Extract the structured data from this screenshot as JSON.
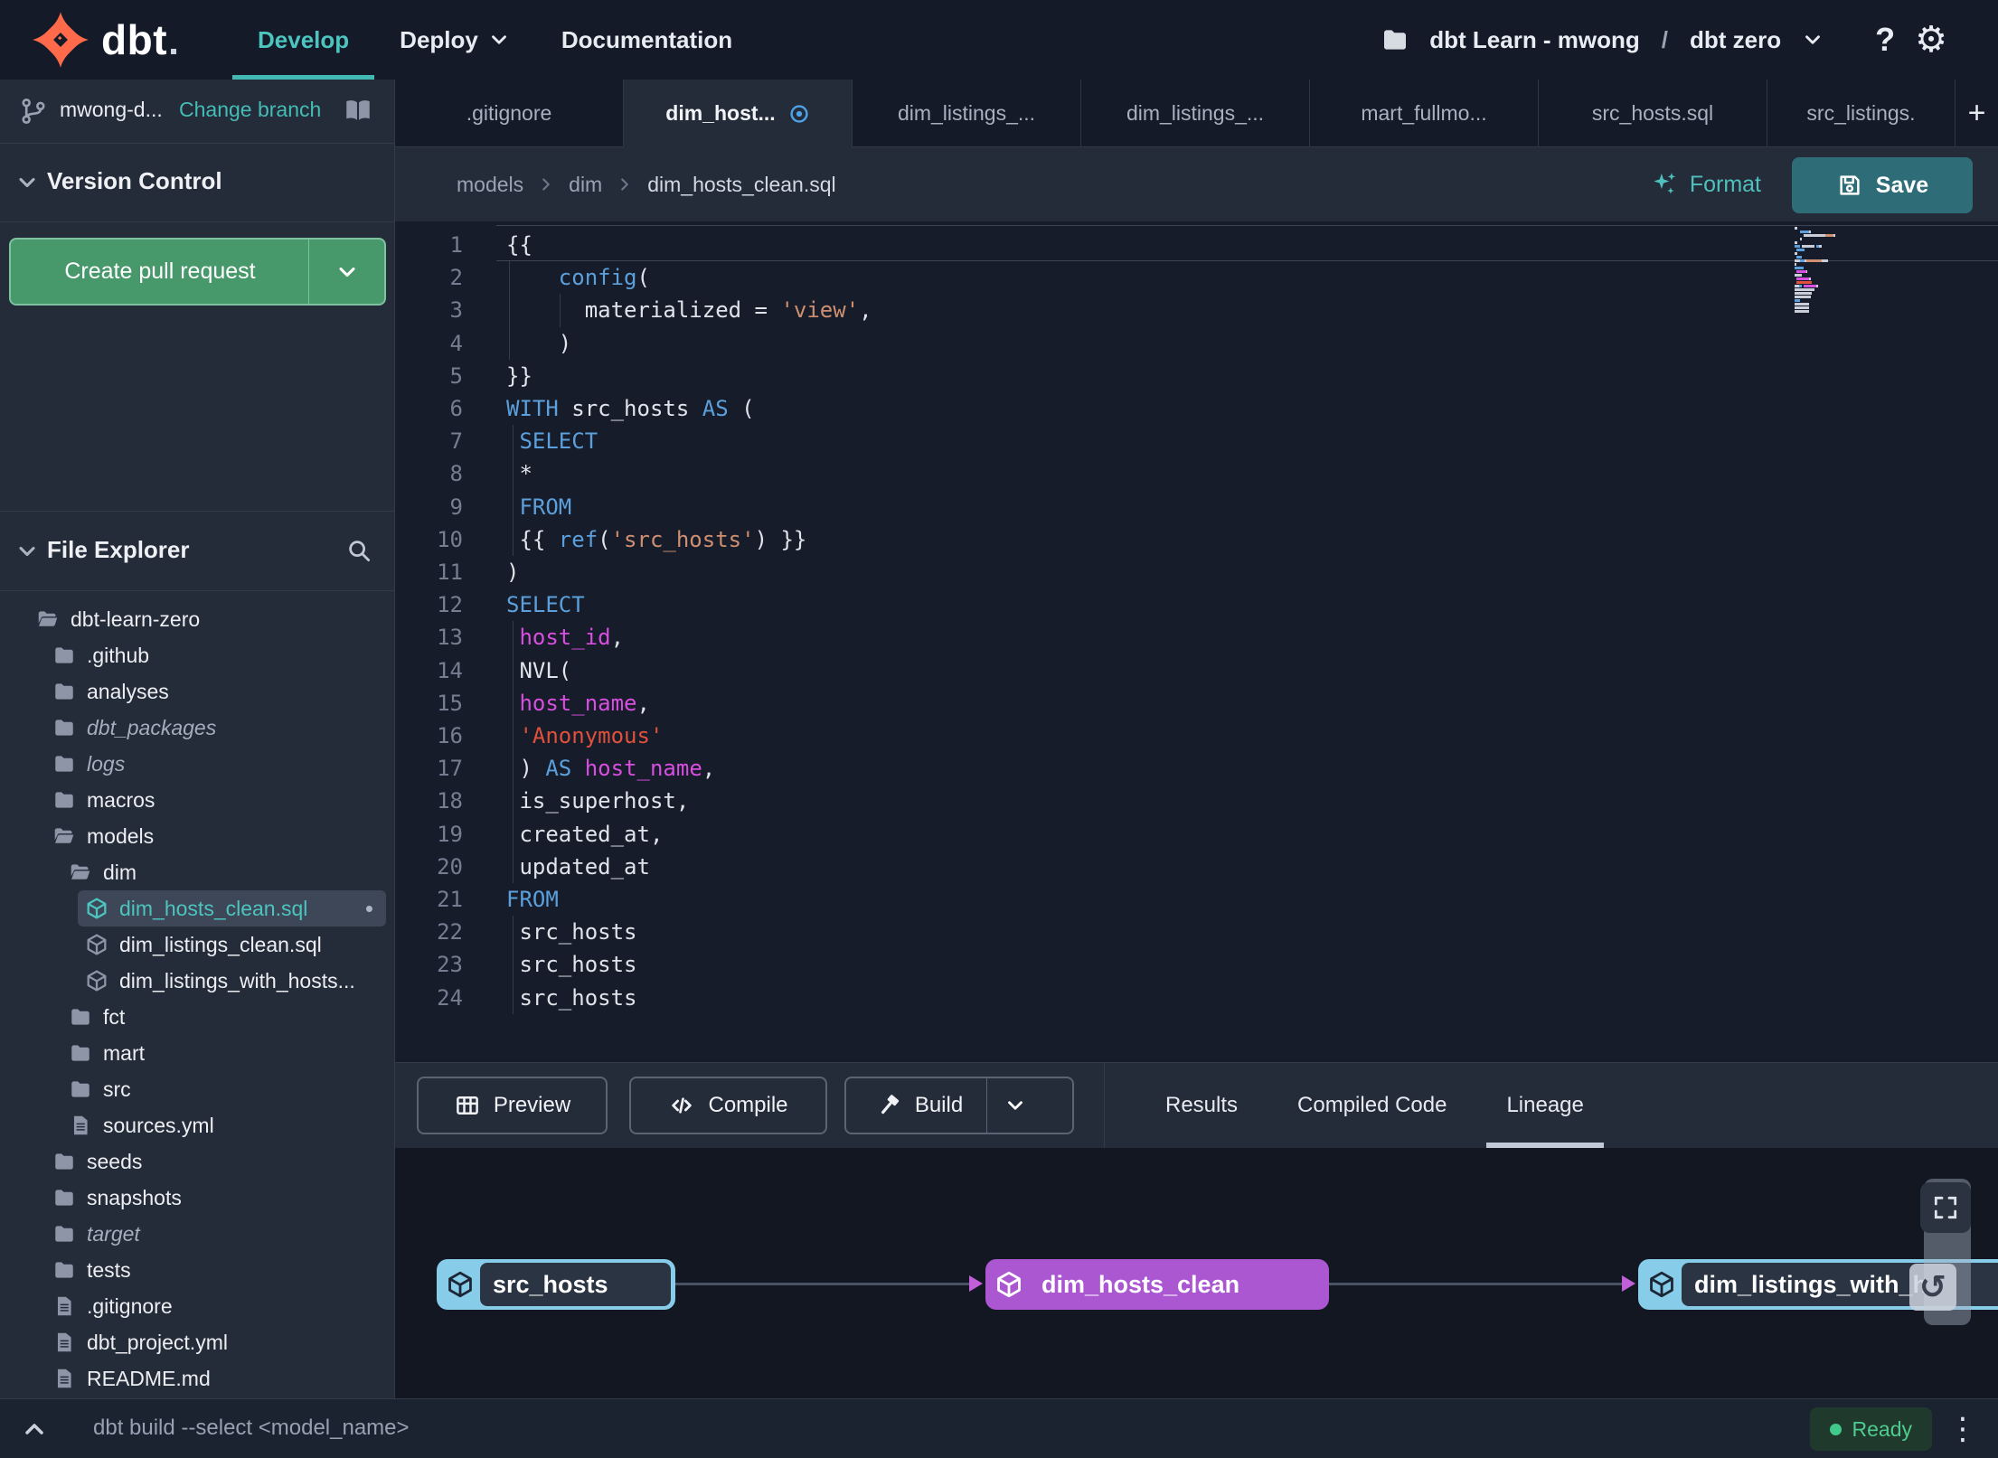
{
  "nav": {
    "brand": "dbt",
    "links": [
      {
        "label": "Develop",
        "active": true
      },
      {
        "label": "Deploy",
        "has_dropdown": true
      },
      {
        "label": "Documentation"
      }
    ],
    "project": {
      "name": "dbt Learn - mwong",
      "separator": "/",
      "environment": "dbt zero"
    }
  },
  "sidebar": {
    "branch": {
      "name": "mwong-d...",
      "action": "Change branch"
    },
    "version_control": {
      "title": "Version Control",
      "create_pr_label": "Create pull request"
    },
    "file_explorer": {
      "title": "File Explorer",
      "tree": [
        {
          "label": "dbt-learn-zero",
          "icon": "folder-open",
          "level": 1
        },
        {
          "label": ".github",
          "icon": "folder",
          "level": 2
        },
        {
          "label": "analyses",
          "icon": "folder",
          "level": 2
        },
        {
          "label": "dbt_packages",
          "icon": "folder",
          "level": 2,
          "italic": true
        },
        {
          "label": "logs",
          "icon": "folder",
          "level": 2,
          "italic": true
        },
        {
          "label": "macros",
          "icon": "folder",
          "level": 2
        },
        {
          "label": "models",
          "icon": "folder-open",
          "level": 2
        },
        {
          "label": "dim",
          "icon": "folder-open",
          "level": 3
        },
        {
          "label": "dim_hosts_clean.sql",
          "icon": "model",
          "level": 4,
          "selected": true,
          "modified": true
        },
        {
          "label": "dim_listings_clean.sql",
          "icon": "model",
          "level": 4
        },
        {
          "label": "dim_listings_with_hosts...",
          "icon": "model",
          "level": 4
        },
        {
          "label": "fct",
          "icon": "folder",
          "level": 3
        },
        {
          "label": "mart",
          "icon": "folder",
          "level": 3
        },
        {
          "label": "src",
          "icon": "folder",
          "level": 3
        },
        {
          "label": "sources.yml",
          "icon": "file",
          "level": 3
        },
        {
          "label": "seeds",
          "icon": "folder",
          "level": 2
        },
        {
          "label": "snapshots",
          "icon": "folder",
          "level": 2
        },
        {
          "label": "target",
          "icon": "folder",
          "level": 2,
          "italic": true
        },
        {
          "label": "tests",
          "icon": "folder",
          "level": 2
        },
        {
          "label": ".gitignore",
          "icon": "file",
          "level": 2
        },
        {
          "label": "dbt_project.yml",
          "icon": "file",
          "level": 2
        },
        {
          "label": "README.md",
          "icon": "file",
          "level": 2
        }
      ]
    }
  },
  "tabs": {
    "items": [
      {
        "label": ".gitignore"
      },
      {
        "label": "dim_host...",
        "active": true,
        "modified": true
      },
      {
        "label": "dim_listings_..."
      },
      {
        "label": "dim_listings_..."
      },
      {
        "label": "mart_fullmo..."
      },
      {
        "label": "src_hosts.sql"
      },
      {
        "label": "src_listings."
      }
    ],
    "add_label": "+"
  },
  "editor": {
    "breadcrumb": [
      "models",
      "dim",
      "dim_hosts_clean.sql"
    ],
    "actions": {
      "format": "Format",
      "save": "Save"
    },
    "code_lines": [
      {
        "tokens": [
          [
            "{{",
            "p"
          ]
        ]
      },
      {
        "tokens": [
          [
            "    ",
            "p"
          ],
          [
            "config",
            "k"
          ],
          [
            "(",
            "p"
          ]
        ]
      },
      {
        "tokens": [
          [
            "      ",
            "p"
          ],
          [
            "materialized",
            "p"
          ],
          [
            " = ",
            "p"
          ],
          [
            "'view'",
            "s"
          ],
          [
            ",",
            "p"
          ]
        ]
      },
      {
        "tokens": [
          [
            "    ",
            "p"
          ],
          [
            ")",
            "p"
          ]
        ]
      },
      {
        "tokens": [
          [
            "}}",
            "p"
          ]
        ]
      },
      {
        "tokens": [
          [
            "WITH",
            "k"
          ],
          [
            " ",
            "p"
          ],
          [
            "src_hosts",
            "p"
          ],
          [
            " ",
            "p"
          ],
          [
            "AS",
            "k"
          ],
          [
            " (",
            "p"
          ]
        ]
      },
      {
        "tokens": [
          [
            " ",
            "p"
          ],
          [
            "SELECT",
            "k"
          ]
        ]
      },
      {
        "tokens": [
          [
            " *",
            "p"
          ]
        ]
      },
      {
        "tokens": [
          [
            " ",
            "p"
          ],
          [
            "FROM",
            "k"
          ]
        ]
      },
      {
        "tokens": [
          [
            " {{ ",
            "p"
          ],
          [
            "ref",
            "k"
          ],
          [
            "(",
            "p"
          ],
          [
            "'src_hosts'",
            "s"
          ],
          [
            ") }}",
            "p"
          ]
        ]
      },
      {
        "tokens": [
          [
            ")",
            "p"
          ]
        ]
      },
      {
        "tokens": [
          [
            "SELECT",
            "k"
          ]
        ]
      },
      {
        "tokens": [
          [
            " ",
            "p"
          ],
          [
            "host_id",
            "m"
          ],
          [
            ",",
            "p"
          ]
        ]
      },
      {
        "tokens": [
          [
            " NVL(",
            "p"
          ]
        ]
      },
      {
        "tokens": [
          [
            " ",
            "p"
          ],
          [
            "host_name",
            "m"
          ],
          [
            ",",
            "p"
          ]
        ]
      },
      {
        "tokens": [
          [
            " ",
            "p"
          ],
          [
            "'Anonymous'",
            "r"
          ]
        ]
      },
      {
        "tokens": [
          [
            " ) ",
            "p"
          ],
          [
            "AS",
            "k"
          ],
          [
            " ",
            "p"
          ],
          [
            "host_name",
            "m"
          ],
          [
            ",",
            "p"
          ]
        ]
      },
      {
        "tokens": [
          [
            " is_superhost,",
            "p"
          ]
        ]
      },
      {
        "tokens": [
          [
            " created_at,",
            "p"
          ]
        ]
      },
      {
        "tokens": [
          [
            " updated_at",
            "p"
          ]
        ]
      },
      {
        "tokens": [
          [
            "FROM",
            "k"
          ]
        ]
      },
      {
        "tokens": [
          [
            " src_hosts",
            "p"
          ]
        ]
      },
      {
        "tokens": [
          [
            " src_hosts",
            "p"
          ]
        ]
      },
      {
        "tokens": [
          [
            " src_hosts",
            "p"
          ]
        ]
      }
    ]
  },
  "result_panel": {
    "buttons": [
      {
        "label": "Preview",
        "icon": "table"
      },
      {
        "label": "Compile",
        "icon": "code"
      },
      {
        "label": "Build",
        "icon": "hammer",
        "split": true
      }
    ],
    "tabs": [
      {
        "label": "Results"
      },
      {
        "label": "Compiled Code"
      },
      {
        "label": "Lineage",
        "active": true
      }
    ]
  },
  "lineage": {
    "nodes": [
      {
        "label": "src_hosts",
        "style": "source"
      },
      {
        "label": "dim_hosts_clean",
        "style": "model-selected"
      },
      {
        "label": "dim_listings_with_h",
        "style": "source"
      }
    ]
  },
  "command_bar": {
    "command": "dbt build --select <model_name>",
    "status": "Ready"
  },
  "colors": {
    "accent_teal": "#45bcb6",
    "keyword_blue": "#5ba0dc",
    "string_salmon": "#cf8f70",
    "string_red": "#e0513c",
    "identifier_magenta": "#d84ee0",
    "node_blue": "#87cce9",
    "node_purple": "#ab57d2",
    "pr_green": "#47986b",
    "save_teal": "#2e6d78",
    "ready_green": "#41c98c"
  }
}
